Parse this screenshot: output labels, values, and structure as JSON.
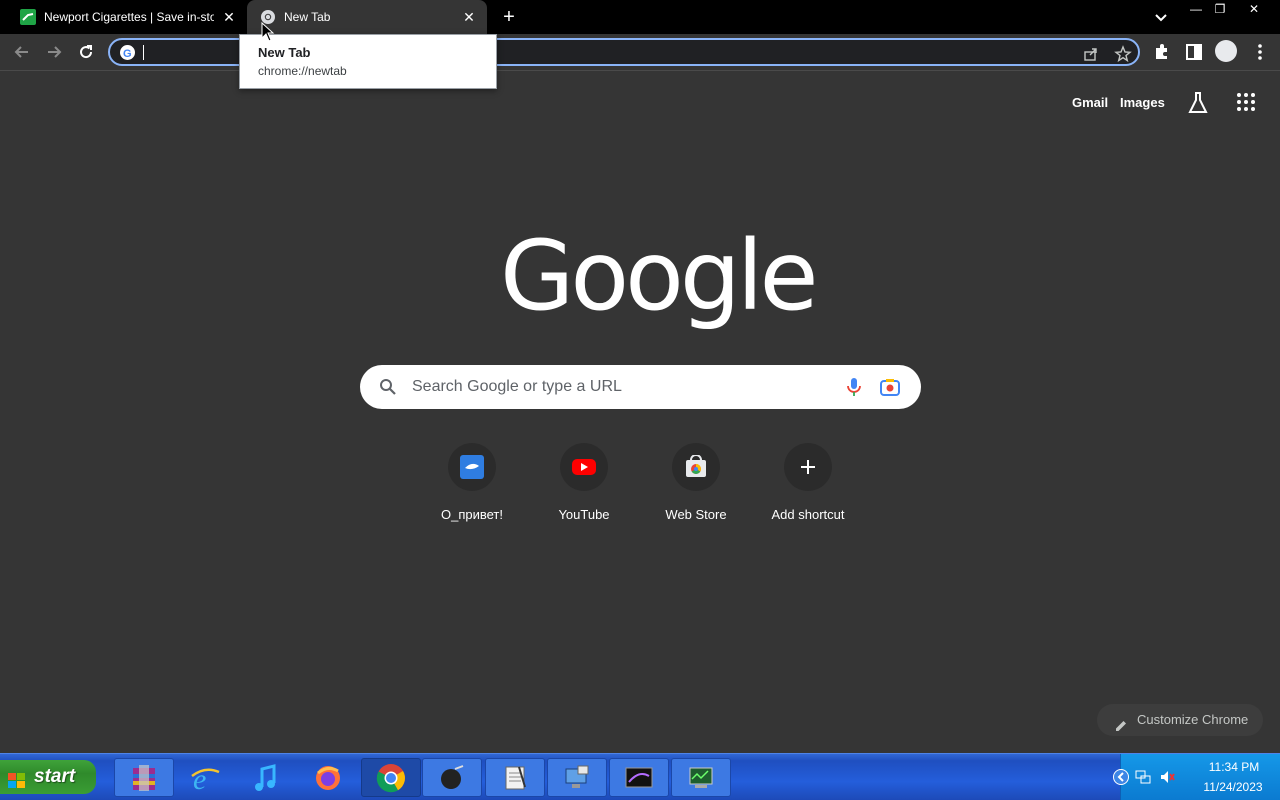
{
  "browser": {
    "tabs": [
      {
        "title": "Newport Cigarettes | Save in-store w",
        "active": false
      },
      {
        "title": "New Tab",
        "active": true
      }
    ],
    "hover_card": {
      "title": "New Tab",
      "url": "chrome://newtab"
    },
    "omnibox": {
      "value": ""
    }
  },
  "page": {
    "top_links": {
      "gmail": "Gmail",
      "images": "Images"
    },
    "logo_text": "Google",
    "search_placeholder": "Search Google or type a URL",
    "shortcuts": [
      {
        "label": "О_привет!",
        "icon": "site-favicon"
      },
      {
        "label": "YouTube",
        "icon": "youtube-icon"
      },
      {
        "label": "Web Store",
        "icon": "webstore-icon"
      },
      {
        "label": "Add shortcut",
        "icon": "plus-icon"
      }
    ],
    "customize_label": "Customize Chrome"
  },
  "taskbar": {
    "start_label": "start",
    "apps": [
      "winrar",
      "internet-explorer",
      "itunes",
      "firefox",
      "chrome",
      "media-app",
      "notepad",
      "display-settings",
      "screensaver",
      "system-monitor"
    ],
    "clock_time": "11:34 PM",
    "clock_date": "11/24/2023"
  },
  "colors": {
    "accent": "#8ab4f8",
    "page_bg": "#353535",
    "taskbar": "#245edb"
  }
}
